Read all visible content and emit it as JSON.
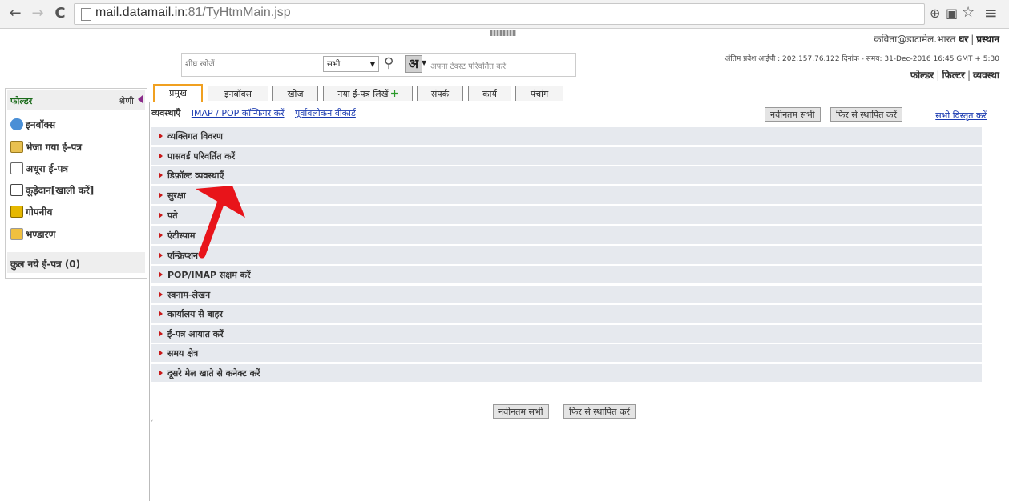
{
  "browser": {
    "back_icon": "←",
    "forward_icon": "→",
    "reload_icon": "C",
    "url_host": "mail.datamail.in",
    "url_path": ":81/TyHtmMain.jsp",
    "zoom_icon": "⊕",
    "translate_icon": "▣",
    "star_icon": "☆",
    "menu_icon": "≡"
  },
  "header": {
    "user": "कविता@डाटामेल.भारत",
    "home": "घर",
    "logout": "प्रस्थान",
    "last_login": "अंतिम प्रवेश आईपी : 202.157.76.122 दिनांक - समय: 31-Dec-2016 16:45 GMT + 5:30",
    "links": [
      "फोल्डर",
      "फिल्टर",
      "व्यवस्था"
    ]
  },
  "search": {
    "placeholder": "शीघ्र खोजें",
    "scope": "सभी",
    "lang_letter": "अ",
    "lang_hint": "अपना टेक्स्ट परिवर्तित करे"
  },
  "sidebar": {
    "title": "फोल्डर",
    "category": "श्रेणी",
    "items": [
      {
        "label": "इनबॉक्स",
        "icon": "inbox-icon"
      },
      {
        "label": "भेजा गया ई-पत्र",
        "icon": "sent-icon"
      },
      {
        "label": "अधूरा ई-पत्र",
        "icon": "draft-icon"
      },
      {
        "label": "कूड़ेदान[खाली करें]",
        "icon": "trash-icon"
      },
      {
        "label": "गोपनीय",
        "icon": "lock-icon"
      },
      {
        "label": "भण्डारण",
        "icon": "storage-icon"
      }
    ],
    "total": "कुल नये ई-पत्र (0)"
  },
  "tabs": [
    "प्रमुख",
    "इनबॉक्स",
    "खोज",
    "नया ई-पत्र लिखें",
    "संपर्क",
    "कार्य",
    "पंचांग"
  ],
  "settings": {
    "label": "व्यवस्थाएँ",
    "links": [
      "IMAP / POP कॉन्फिगर करें",
      "पूर्वावलोकन वीकार्ड"
    ],
    "btn_latest": "नवीनतम सभी",
    "btn_reset": "फिर से स्थापित करें",
    "expand_all": "सभी विस्तृत करें",
    "rows": [
      "व्यक्तिगत विवरण",
      "पासवर्ड परिवर्तित करें",
      "डिफ़ॉल्ट व्यवस्थाएँ",
      "सुरक्षा",
      "पते",
      "एंटीस्पाम",
      "एन्क्रिप्शन",
      "POP/IMAP सक्षम करें",
      "स्वनाम-लेखन",
      "कार्यालय से बाहर",
      "ई-पत्र आयात करें",
      "समय क्षेत्र",
      "दूसरे मेल खाते से कनेक्ट करें"
    ],
    "bottom_latest": "नवीनतम सभी",
    "bottom_reset": "फिर से स्थापित करें"
  },
  "colors": {
    "annotation_arrow": "#e8141a",
    "active_tab_border": "#f0a020",
    "row_bg": "#e6e9ee"
  }
}
